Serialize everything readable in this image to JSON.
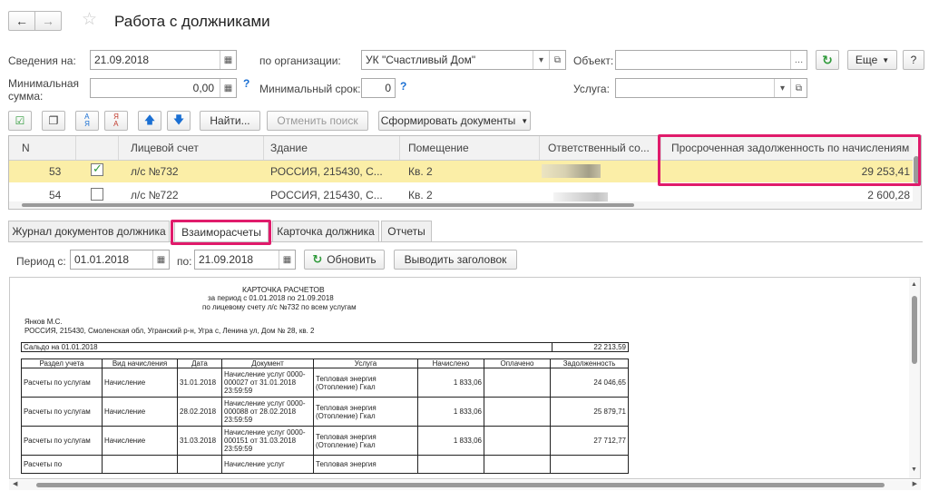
{
  "window": {
    "title": "Работа с должниками"
  },
  "filters": {
    "info_date_label": "Сведения на:",
    "info_date": "21.09.2018",
    "org_label": "по организации:",
    "org_value": "УК \"Счастливый Дом\"",
    "object_label": "Объект:",
    "object_value": "",
    "min_sum_label_1": "Минимальная",
    "min_sum_label_2": "сумма:",
    "min_sum_value": "0,00",
    "min_term_label": "Минимальный срок:",
    "min_term_value": "0",
    "service_label": "Услуга:",
    "service_value": "",
    "help": "?",
    "more_label": "Еще",
    "help_button": "?"
  },
  "toolbar": {
    "find_label": "Найти...",
    "cancel_search_label": "Отменить поиск",
    "form_docs_label": "Сформировать документы"
  },
  "grid": {
    "columns": [
      "N",
      "Лицевой счет",
      "Здание",
      "Помещение",
      "Ответственный со...",
      "Просроченная задолженность по начислениям"
    ],
    "rows": [
      {
        "n": "53",
        "checked": true,
        "account": "л/с №732",
        "building": "РОССИЯ, 215430, С...",
        "room": "Кв. 2",
        "debt": "29 253,41"
      },
      {
        "n": "54",
        "checked": false,
        "account": "л/с №722",
        "building": "РОССИЯ, 215430, С...",
        "room": "Кв. 2",
        "debt": "2 600,28"
      }
    ]
  },
  "tabs": [
    "Журнал документов должника",
    "Взаиморасчеты",
    "Карточка должника",
    "Отчеты"
  ],
  "period": {
    "label": "Период с:",
    "from": "01.01.2018",
    "to_label": "по:",
    "to": "21.09.2018",
    "refresh_label": "Обновить",
    "header_label": "Выводить заголовок"
  },
  "report": {
    "title": "КАРТОЧКА РАСЧЕТОВ",
    "period_line": "за период с 01.01.2018 по 21.09.2018",
    "account_line": "по лицевому счету л/с №732 по всем услугам",
    "person": "Янков М.С.",
    "address": "РОССИЯ, 215430, Смоленская обл, Угранский р-н, Угра с, Ленина ул, Дом № 28, кв. 2",
    "opening_label": "Сальдо на 01.01.2018",
    "opening_value": "22 213,59",
    "headers": [
      "Раздел учета",
      "Вид начисления",
      "Дата",
      "Документ",
      "Услуга",
      "Начислено",
      "Оплачено",
      "Задолженность"
    ],
    "rows": [
      {
        "section": "Расчеты по услугам",
        "kind": "Начисление",
        "date": "31.01.2018",
        "doc": "Начисление услуг 0000-000027 от 31.01.2018 23:59:59",
        "service": "Тепловая энергия (Отопление) Гкал",
        "charged": "1 833,06",
        "paid": "",
        "debt": "24 046,65"
      },
      {
        "section": "Расчеты по услугам",
        "kind": "Начисление",
        "date": "28.02.2018",
        "doc": "Начисление услуг 0000-000088 от 28.02.2018 23:59:59",
        "service": "Тепловая энергия (Отопление) Гкал",
        "charged": "1 833,06",
        "paid": "",
        "debt": "25 879,71"
      },
      {
        "section": "Расчеты по услугам",
        "kind": "Начисление",
        "date": "31.03.2018",
        "doc": "Начисление услуг 0000-000151 от 31.03.2018 23:59:59",
        "service": "Тепловая энергия (Отопление) Гкал",
        "charged": "1 833,06",
        "paid": "",
        "debt": "27 712,77"
      },
      {
        "section": "Расчеты по",
        "kind": "",
        "date": "",
        "doc": "Начисление услуг",
        "service": "Тепловая энергия",
        "charged": "",
        "paid": "",
        "debt": ""
      }
    ]
  },
  "colors": {
    "highlight": "#e01b6b",
    "selected_row": "#fbeea7",
    "accent_green": "#2f9a3a",
    "accent_blue": "#1a6fd3"
  }
}
